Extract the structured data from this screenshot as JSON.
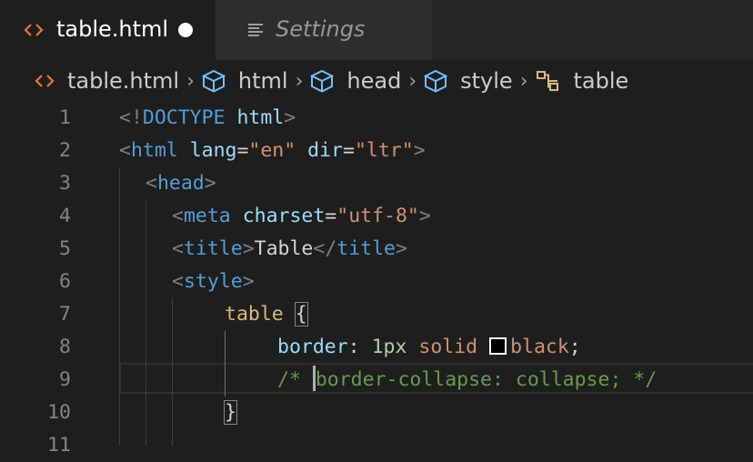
{
  "tabs": [
    {
      "label": "table.html",
      "icon": "html-code-icon",
      "active": true,
      "dirty": true
    },
    {
      "label": "Settings",
      "icon": "settings-list-icon",
      "active": false
    }
  ],
  "breadcrumb": [
    {
      "label": "table.html",
      "icon": "html-code-icon"
    },
    {
      "label": "html",
      "icon": "cube-icon"
    },
    {
      "label": "head",
      "icon": "cube-icon"
    },
    {
      "label": "style",
      "icon": "cube-icon"
    },
    {
      "label": "table",
      "icon": "css-selector-icon"
    }
  ],
  "colors": {
    "accent_orange": "#e37933",
    "symbol_blue": "#75beff",
    "selector_gold": "#d7ba7d"
  },
  "editor": {
    "line_numbers": [
      "1",
      "2",
      "3",
      "4",
      "5",
      "6",
      "7",
      "8",
      "9",
      "10",
      "11"
    ],
    "lines": {
      "l1": {
        "open": "<!",
        "kw": "DOCTYPE",
        "attr": "html",
        "close": ">"
      },
      "l2": {
        "open": "<",
        "tag": "html",
        "attr1": "lang",
        "eq1": "=",
        "val1": "\"en\"",
        "attr2": "dir",
        "eq2": "=",
        "val2": "\"ltr\"",
        "close": ">"
      },
      "l3": {
        "open": "<",
        "tag": "head",
        "close": ">"
      },
      "l4": {
        "open": "<",
        "tag": "meta",
        "attr": "charset",
        "eq": "=",
        "val": "\"utf-8\"",
        "close": ">"
      },
      "l5": {
        "open": "<",
        "tag": "title",
        "close": ">",
        "text": "Table",
        "open2": "</",
        "tag2": "title",
        "close2": ">"
      },
      "l6": {
        "open": "<",
        "tag": "style",
        "close": ">"
      },
      "l7": {
        "selector": "table",
        "brace": "{"
      },
      "l8": {
        "prop": "border",
        "colon": ":",
        "num": "1px",
        "kw": "solid",
        "color": "black",
        "semi": ";"
      },
      "l9": {
        "comment_start": "/*",
        "comment_rest": "border-collapse: collapse; */"
      },
      "l10": {
        "brace": "}"
      }
    }
  }
}
